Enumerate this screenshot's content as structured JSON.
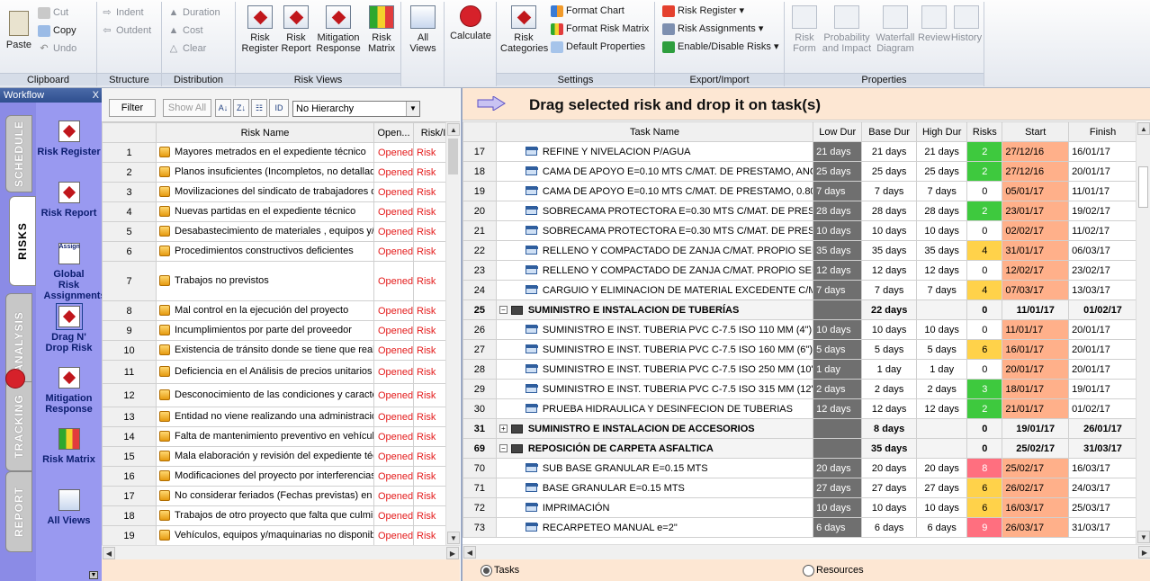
{
  "ribbon": {
    "clipboard": {
      "label": "Clipboard",
      "paste": "Paste",
      "cut": "Cut",
      "copy": "Copy",
      "undo": "Undo"
    },
    "structure": {
      "label": "Structure",
      "indent": "Indent",
      "outdent": "Outdent"
    },
    "distribution": {
      "label": "Distribution",
      "duration": "Duration",
      "cost": "Cost",
      "clear": "Clear"
    },
    "risk_views": {
      "label": "Risk Views",
      "items": [
        {
          "line1": "Risk",
          "line2": "Register"
        },
        {
          "line1": "Risk",
          "line2": "Report"
        },
        {
          "line1": "Mitigation",
          "line2": "Response"
        },
        {
          "line1": "Risk",
          "line2": "Matrix"
        }
      ]
    },
    "all_views": {
      "line1": "All",
      "line2": "Views"
    },
    "calculate": "Calculate",
    "settings": {
      "label": "Settings",
      "risk_categories_1": "Risk",
      "risk_categories_2": "Categories",
      "format_chart": "Format Chart",
      "format_risk_matrix": "Format Risk Matrix",
      "default_properties": "Default Properties"
    },
    "export_import": {
      "label": "Export/Import",
      "risk_register": "Risk Register ▾",
      "risk_assignments": "Risk Assignments ▾",
      "enable_disable": "Enable/Disable Risks ▾"
    },
    "properties": {
      "label": "Properties",
      "items": [
        {
          "line1": "Risk",
          "line2": "Form"
        },
        {
          "line1": "Probability",
          "line2": "and Impact"
        },
        {
          "line1": "Waterfall",
          "line2": "Diagram"
        },
        {
          "line1": "Review",
          "line2": ""
        },
        {
          "line1": "History",
          "line2": ""
        }
      ]
    }
  },
  "workflow": {
    "title": "Workflow",
    "close": "X",
    "tabs": [
      "SCHEDULE",
      "RISKS",
      "ANALYSIS",
      "TRACKING",
      "REPORT"
    ],
    "items": [
      "Risk Register",
      "Risk Report",
      "Global Risk Assignments",
      "Drag N' Drop Risk",
      "Mitigation Response",
      "Risk Matrix",
      "All Views"
    ],
    "assign_text": "Assign"
  },
  "risk_pane": {
    "filter": "Filter",
    "show_all": "Show All",
    "hierarchy": "No Hierarchy",
    "columns": [
      "",
      "Risk Name",
      "Open...",
      "Risk/I"
    ],
    "rows": [
      {
        "n": "1",
        "name": "Mayores metrados en el expediente técnico",
        "status": "Opened",
        "risk": "Risk"
      },
      {
        "n": "2",
        "name": "Planos insuficientes (Incompletos, no detallado,",
        "status": "Opened",
        "risk": "Risk"
      },
      {
        "n": "3",
        "name": "Movilizaciones del sindicato de trabajadores de",
        "status": "Opened",
        "risk": "Risk"
      },
      {
        "n": "4",
        "name": "Nuevas partidas en el expediente técnico",
        "status": "Opened",
        "risk": "Risk"
      },
      {
        "n": "5",
        "name": "Desabastecimiento de materiales , equipos y/ o",
        "status": "Opened",
        "risk": "Risk"
      },
      {
        "n": "6",
        "name": "Procedimientos constructivos deficientes",
        "status": "Opened",
        "risk": "Risk"
      },
      {
        "n": "7",
        "name": "Trabajos no previstos",
        "status": "Opened",
        "risk": "Risk"
      },
      {
        "n": "8",
        "name": "Mal control en la ejecución del proyecto",
        "status": "Opened",
        "risk": "Risk"
      },
      {
        "n": "9",
        "name": "Incumplimientos por parte del proveedor",
        "status": "Opened",
        "risk": "Risk"
      },
      {
        "n": "10",
        "name": "Existencia de tránsito donde se tiene que realiza",
        "status": "Opened",
        "risk": "Risk"
      },
      {
        "n": "11",
        "name": "Deficiencia en el Análisis de precios unitarios",
        "status": "Opened",
        "risk": "Risk"
      },
      {
        "n": "12",
        "name": "Desconocimiento de las condiciones y caracteri",
        "status": "Opened",
        "risk": "Risk"
      },
      {
        "n": "13",
        "name": "Entidad no viene realizando una administración y",
        "status": "Opened",
        "risk": "Risk"
      },
      {
        "n": "14",
        "name": "Falta de mantenimiento preventivo en vehículos,",
        "status": "Opened",
        "risk": "Risk"
      },
      {
        "n": "15",
        "name": "Mala elaboración y revisión del expediente técni",
        "status": "Opened",
        "risk": "Risk"
      },
      {
        "n": "16",
        "name": "Modificaciones del proyecto por interferencias",
        "status": "Opened",
        "risk": "Risk"
      },
      {
        "n": "17",
        "name": "No considerar feriados (Fechas previstas) en c",
        "status": "Opened",
        "risk": "Risk"
      },
      {
        "n": "18",
        "name": "Trabajos de otro proyecto que falta que culmine",
        "status": "Opened",
        "risk": "Risk"
      },
      {
        "n": "19",
        "name": "Vehículos, equipos y/maquinarias no disponible",
        "status": "Opened",
        "risk": "Risk"
      }
    ]
  },
  "task_pane": {
    "drag_text": "Drag selected risk and drop it on task(s)",
    "columns": [
      "",
      "Task Name",
      "Low Dur",
      "Base Dur",
      "High Dur",
      "Risks",
      "Start",
      "Finish"
    ],
    "rows": [
      {
        "n": "17",
        "name": "REFINE Y NIVELACION P/AGUA",
        "low": "21 days",
        "base": "21 days",
        "high": "21 days",
        "risks": "2",
        "start": "27/12/16",
        "finish": "16/01/17",
        "rc": "g"
      },
      {
        "n": "18",
        "name": "CAMA DE APOYO E=0.10 MTS C/MAT. DE PRESTAMO, ANCH",
        "low": "25 days",
        "base": "25 days",
        "high": "25 days",
        "risks": "2",
        "start": "27/12/16",
        "finish": "20/01/17",
        "rc": "g"
      },
      {
        "n": "19",
        "name": "CAMA DE APOYO E=0.10 MTS C/MAT. DE PRESTAMO, 0.80M",
        "low": "7 days",
        "base": "7 days",
        "high": "7 days",
        "risks": "0",
        "start": "05/01/17",
        "finish": "11/01/17",
        "rc": ""
      },
      {
        "n": "20",
        "name": "SOBRECAMA PROTECTORA E=0.30 MTS C/MAT. DE PRESTA",
        "low": "28 days",
        "base": "28 days",
        "high": "28 days",
        "risks": "2",
        "start": "23/01/17",
        "finish": "19/02/17",
        "rc": "g"
      },
      {
        "n": "21",
        "name": "SOBRECAMA PROTECTORA E=0.30 MTS C/MAT. DE PRESTA",
        "low": "10 days",
        "base": "10 days",
        "high": "10 days",
        "risks": "0",
        "start": "02/02/17",
        "finish": "11/02/17",
        "rc": ""
      },
      {
        "n": "22",
        "name": "RELLENO Y COMPACTADO DE ZANJA C/MAT. PROPIO SELE",
        "low": "35 days",
        "base": "35 days",
        "high": "35 days",
        "risks": "4",
        "start": "31/01/17",
        "finish": "06/03/17",
        "rc": "y"
      },
      {
        "n": "23",
        "name": "RELLENO Y COMPACTADO DE ZANJA C/MAT. PROPIO SELE",
        "low": "12 days",
        "base": "12 days",
        "high": "12 days",
        "risks": "0",
        "start": "12/02/17",
        "finish": "23/02/17",
        "rc": ""
      },
      {
        "n": "24",
        "name": "CARGUIO Y ELIMINACION DE MATERIAL EXCEDENTE C/MAC",
        "low": "7 days",
        "base": "7 days",
        "high": "7 days",
        "risks": "4",
        "start": "07/03/17",
        "finish": "13/03/17",
        "rc": "y"
      },
      {
        "n": "25",
        "name": "SUMINISTRO E INSTALACION DE TUBERÍAS",
        "low": "",
        "base": "22 days",
        "high": "",
        "risks": "0",
        "start": "11/01/17",
        "finish": "01/02/17",
        "rc": "",
        "sum": true,
        "exp": "−"
      },
      {
        "n": "26",
        "name": "SUMINISTRO E INST. TUBERIA PVC C-7.5 ISO 110 MM (4\")",
        "low": "10 days",
        "base": "10 days",
        "high": "10 days",
        "risks": "0",
        "start": "11/01/17",
        "finish": "20/01/17",
        "rc": ""
      },
      {
        "n": "27",
        "name": "SUMINISTRO E INST. TUBERIA PVC C-7.5 ISO 160 MM (6\")",
        "low": "5 days",
        "base": "5 days",
        "high": "5 days",
        "risks": "6",
        "start": "16/01/17",
        "finish": "20/01/17",
        "rc": "y"
      },
      {
        "n": "28",
        "name": "SUMINISTRO E INST. TUBERIA PVC C-7.5 ISO 250 MM (10\")",
        "low": "1 day",
        "base": "1 day",
        "high": "1 day",
        "risks": "0",
        "start": "20/01/17",
        "finish": "20/01/17",
        "rc": ""
      },
      {
        "n": "29",
        "name": "SUMINISTRO E INST. TUBERIA PVC C-7.5 ISO 315 MM (12\")",
        "low": "2 days",
        "base": "2 days",
        "high": "2 days",
        "risks": "3",
        "start": "18/01/17",
        "finish": "19/01/17",
        "rc": "g"
      },
      {
        "n": "30",
        "name": "PRUEBA HIDRAULICA Y DESINFECION DE TUBERIAS",
        "low": "12 days",
        "base": "12 days",
        "high": "12 days",
        "risks": "2",
        "start": "21/01/17",
        "finish": "01/02/17",
        "rc": "g"
      },
      {
        "n": "31",
        "name": "SUMINISTRO E INSTALACION DE ACCESORIOS",
        "low": "",
        "base": "8 days",
        "high": "",
        "risks": "0",
        "start": "19/01/17",
        "finish": "26/01/17",
        "rc": "",
        "sum": true,
        "exp": "+"
      },
      {
        "n": "69",
        "name": "REPOSICIÓN DE CARPETA ASFALTICA",
        "low": "",
        "base": "35 days",
        "high": "",
        "risks": "0",
        "start": "25/02/17",
        "finish": "31/03/17",
        "rc": "",
        "sum": true,
        "exp": "−"
      },
      {
        "n": "70",
        "name": "SUB BASE GRANULAR E=0.15 MTS",
        "low": "20 days",
        "base": "20 days",
        "high": "20 days",
        "risks": "8",
        "start": "25/02/17",
        "finish": "16/03/17",
        "rc": "r"
      },
      {
        "n": "71",
        "name": "BASE GRANULAR E=0.15 MTS",
        "low": "27 days",
        "base": "27 days",
        "high": "27 days",
        "risks": "6",
        "start": "26/02/17",
        "finish": "24/03/17",
        "rc": "y"
      },
      {
        "n": "72",
        "name": "IMPRIMACIÓN",
        "low": "10 days",
        "base": "10 days",
        "high": "10 days",
        "risks": "6",
        "start": "16/03/17",
        "finish": "25/03/17",
        "rc": "y"
      },
      {
        "n": "73",
        "name": "RECARPETEO MANUAL e=2\"",
        "low": "6 days",
        "base": "6 days",
        "high": "6 days",
        "risks": "9",
        "start": "26/03/17",
        "finish": "31/03/17",
        "rc": "r"
      }
    ],
    "radio_tasks": "Tasks",
    "radio_resources": "Resources"
  }
}
